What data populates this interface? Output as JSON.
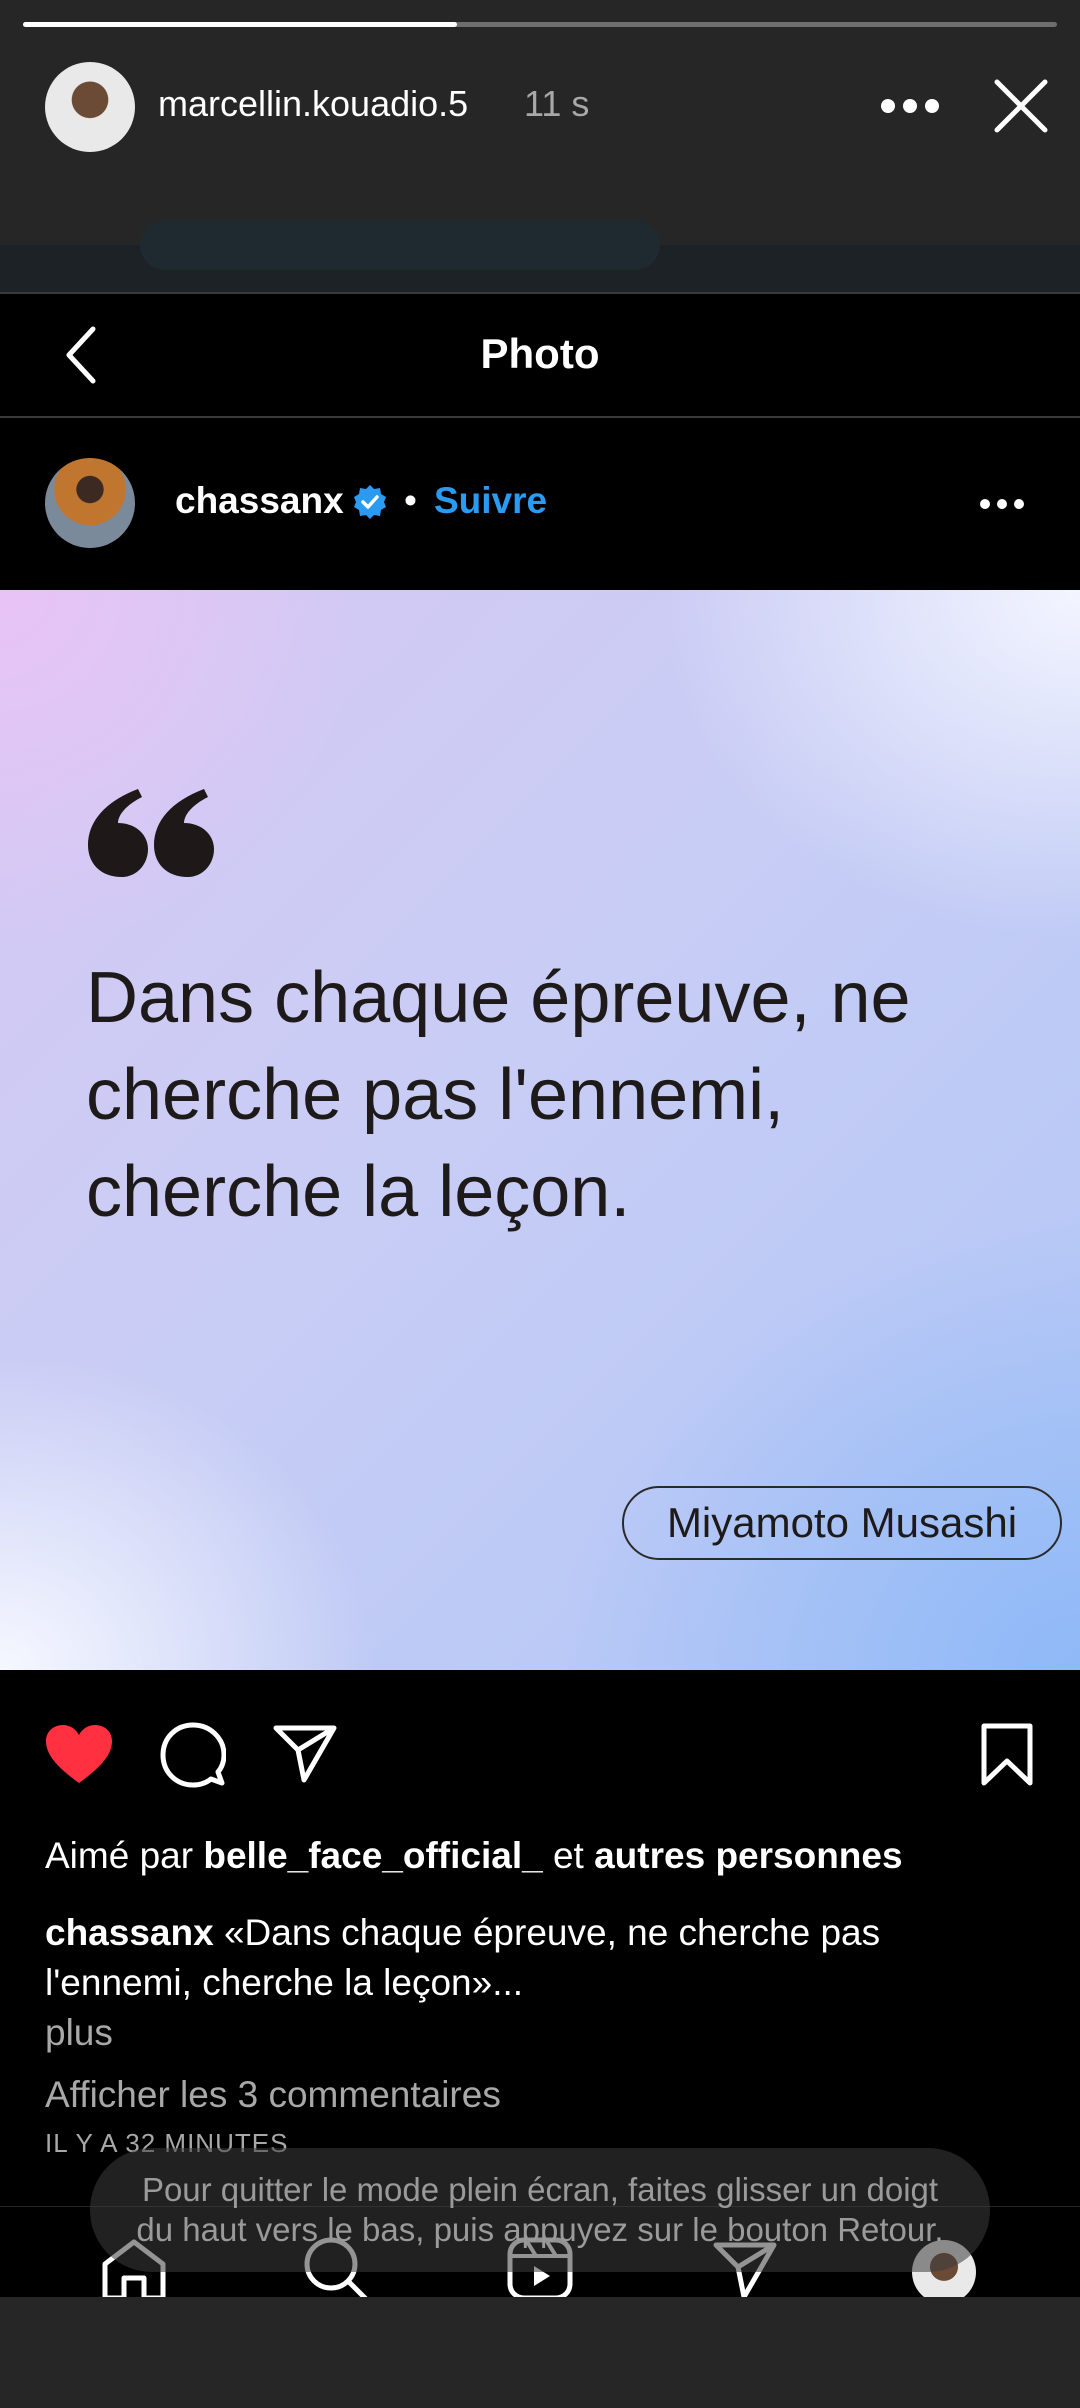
{
  "story": {
    "username": "marcellin.kouadio.5",
    "time": "11 s",
    "progress": 0.42
  },
  "header": {
    "title": "Photo"
  },
  "post": {
    "username": "chassanx",
    "separator": "•",
    "follow_label": "Suivre",
    "quote_lines": [
      "Dans chaque épreuve, ne",
      "cherche pas l'ennemi,",
      "cherche la leçon."
    ],
    "author": "Miyamoto Musashi",
    "liked_prefix": "Aimé par",
    "liked_user": "belle_face_official_",
    "liked_middle": "et",
    "liked_suffix": "autres personnes",
    "caption_user": "chassanx",
    "caption_text": "«Dans chaque épreuve, ne cherche pas l'ennemi, cherche la leçon»...",
    "more_label": "plus",
    "comments_label": "Afficher les 3 commentaires",
    "time_ago": "IL Y A 32 MINUTES"
  },
  "toast": {
    "text": "Pour quitter le mode plein écran, faites glisser un doigt du haut vers le bas, puis appuyez sur le bouton Retour."
  },
  "colors": {
    "accent_blue": "#2a9bf0",
    "like_red": "#ff3040"
  }
}
